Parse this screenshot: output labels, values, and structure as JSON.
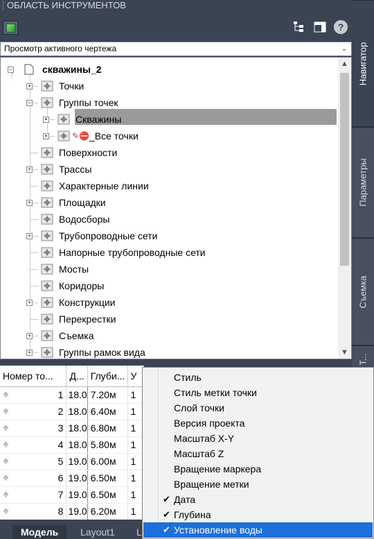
{
  "panel": {
    "title": "ОБЛАСТЬ ИНСТРУМЕНТОВ"
  },
  "side_tabs": [
    {
      "label": "Навигатор"
    },
    {
      "label": "Параметры"
    },
    {
      "label": "Съемка"
    },
    {
      "label": "Т..."
    }
  ],
  "view_select": {
    "value": "Просмотр активного чертежа"
  },
  "tree": {
    "root": "скважины_2",
    "items": [
      {
        "label": "Точки",
        "icon": "point-icon",
        "expander": "dot"
      },
      {
        "label": "Группы точек",
        "icon": "point-group-icon",
        "expander": "minus"
      },
      {
        "label": "Скважины",
        "icon": "point-group-icon",
        "expander": "dot",
        "selected": true
      },
      {
        "label": "_Все точки",
        "icon": "point-group-icon",
        "expander": "dot",
        "flag": "edit-no-icon"
      },
      {
        "label": "Поверхности",
        "icon": "surface-icon",
        "expander": ""
      },
      {
        "label": "Трассы",
        "icon": "alignment-icon",
        "expander": "plus"
      },
      {
        "label": "Характерные линии",
        "icon": "feature-line-icon",
        "expander": ""
      },
      {
        "label": "Площадки",
        "icon": "site-icon",
        "expander": "plus"
      },
      {
        "label": "Водосборы",
        "icon": "catchment-icon",
        "expander": ""
      },
      {
        "label": "Трубопроводные сети",
        "icon": "pipe-network-icon",
        "expander": "plus"
      },
      {
        "label": "Напорные трубопроводные сети",
        "icon": "pressure-network-icon",
        "expander": ""
      },
      {
        "label": "Мосты",
        "icon": "bridge-icon",
        "expander": ""
      },
      {
        "label": "Коридоры",
        "icon": "corridor-icon",
        "expander": ""
      },
      {
        "label": "Конструкции",
        "icon": "assembly-icon",
        "expander": "plus"
      },
      {
        "label": "Перекрестки",
        "icon": "intersection-icon",
        "expander": ""
      },
      {
        "label": "Съемка",
        "icon": "survey-icon",
        "expander": "plus"
      },
      {
        "label": "Группы рамок вида",
        "icon": "view-frame-icon",
        "expander": "plus"
      }
    ]
  },
  "grid": {
    "headers": [
      "Номер то...",
      "Д...",
      "Глуби...",
      "У"
    ],
    "rows": [
      {
        "num": "1",
        "date": "18.0",
        "depth": "7.20м",
        "w": "1"
      },
      {
        "num": "2",
        "date": "18.0",
        "depth": "6.40м",
        "w": "1"
      },
      {
        "num": "3",
        "date": "18.0",
        "depth": "6.80м",
        "w": "1"
      },
      {
        "num": "4",
        "date": "18.0",
        "depth": "5.80м",
        "w": "1"
      },
      {
        "num": "5",
        "date": "19.0",
        "depth": "6.00м",
        "w": "1"
      },
      {
        "num": "6",
        "date": "19.0",
        "depth": "6.50м",
        "w": "1"
      },
      {
        "num": "7",
        "date": "19.0",
        "depth": "6.50м",
        "w": "1"
      },
      {
        "num": "8",
        "date": "19.0",
        "depth": "6.20м",
        "w": "1"
      }
    ]
  },
  "context_menu": {
    "items": [
      {
        "label": "Стиль",
        "checked": false
      },
      {
        "label": "Стиль метки точки",
        "checked": false
      },
      {
        "label": "Слой точки",
        "checked": false
      },
      {
        "label": "Версия проекта",
        "checked": false
      },
      {
        "label": "Масштаб X-Y",
        "checked": false
      },
      {
        "label": "Масштаб Z",
        "checked": false
      },
      {
        "label": "Вращение маркера",
        "checked": false
      },
      {
        "label": "Вращение метки",
        "checked": false
      },
      {
        "label": "Дата",
        "checked": true
      },
      {
        "label": "Глубина",
        "checked": true
      },
      {
        "label": "Установление воды",
        "checked": true,
        "highlighted": true
      }
    ]
  },
  "bottom_tabs": [
    {
      "label": "Модель",
      "active": true
    },
    {
      "label": "Layout1"
    },
    {
      "label": "L"
    }
  ],
  "colors": {
    "panel_bg": "#3b4453",
    "highlight": "#1e6fd9",
    "selection": "#9a9a9a"
  }
}
